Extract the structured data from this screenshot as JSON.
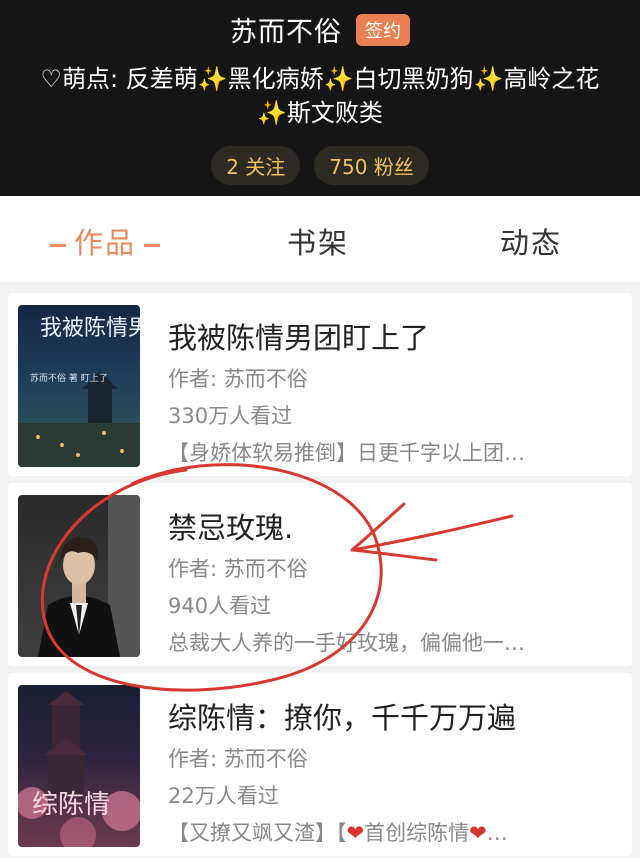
{
  "profile": {
    "name": "苏而不俗",
    "badge": "签约",
    "tags_line1": "♡萌点: 反差萌✨黑化病娇✨白切黑奶狗✨高岭之花",
    "tags_line2": "✨斯文败类",
    "following": "2 关注",
    "followers": "750 粉丝"
  },
  "tabs": [
    {
      "label": "作品",
      "active": true
    },
    {
      "label": "书架",
      "active": false
    },
    {
      "label": "动态",
      "active": false
    }
  ],
  "works": [
    {
      "title": "我被陈情男团盯上了",
      "author": "作者: 苏而不俗",
      "views": "330万人看过",
      "summary": "【身娇体软易推倒】日更千字以上团…",
      "cover_title": "我被陈情男团",
      "cover_sub": "苏而不俗 著 盯上了"
    },
    {
      "title": "禁忌玫瑰.",
      "author": "作者: 苏而不俗",
      "views": "940人看过",
      "summary": "总裁大人养的一手好玫瑰，偏偏他一…"
    },
    {
      "title": "综陈情：撩你，千千万万遍",
      "author": "作者: 苏而不俗",
      "views": "22万人看过",
      "summary_a": "【又撩又飒又渣】【",
      "summary_heart": "❤",
      "summary_b": "首创综陈情",
      "summary_c": "…",
      "cover_title": "综陈情"
    }
  ],
  "colors": {
    "accent": "#ea8a5d",
    "badge": "#ea7f52",
    "header_bg": "#151515",
    "stat_text": "#f1c359",
    "annotation": "#d9382f"
  }
}
